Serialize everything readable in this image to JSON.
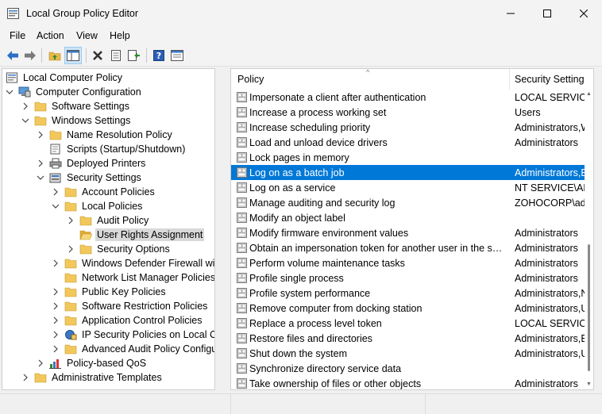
{
  "window": {
    "title": "Local Group Policy Editor",
    "accent": "#0078d7"
  },
  "menu": [
    "File",
    "Action",
    "View",
    "Help"
  ],
  "toolbar": {
    "icons": [
      "back-arrow-icon",
      "forward-arrow-icon",
      "up-folder-icon",
      "show-hide-tree-icon",
      "delete-icon",
      "properties-icon",
      "export-list-icon",
      "help-icon",
      "filter-icon"
    ]
  },
  "tree": {
    "nodes": [
      {
        "label": "Local Computer Policy",
        "icon": "policy-icon"
      },
      {
        "label": "Computer Configuration",
        "icon": "computer-icon"
      },
      {
        "label": "Software Settings",
        "icon": "folder-icon"
      },
      {
        "label": "Windows Settings",
        "icon": "folder-icon"
      },
      {
        "label": "Name Resolution Policy",
        "icon": "folder-icon"
      },
      {
        "label": "Scripts (Startup/Shutdown)",
        "icon": "scripts-icon"
      },
      {
        "label": "Deployed Printers",
        "icon": "printer-icon"
      },
      {
        "label": "Security Settings",
        "icon": "security-icon"
      },
      {
        "label": "Account Policies",
        "icon": "folder-icon"
      },
      {
        "label": "Local Policies",
        "icon": "folder-icon"
      },
      {
        "label": "Audit Policy",
        "icon": "folder-icon"
      },
      {
        "label": "User Rights Assignment",
        "icon": "folder-open-icon"
      },
      {
        "label": "Security Options",
        "icon": "folder-icon"
      },
      {
        "label": "Windows Defender Firewall wit",
        "icon": "folder-icon"
      },
      {
        "label": "Network List Manager Policies",
        "icon": "folder-icon"
      },
      {
        "label": "Public Key Policies",
        "icon": "folder-icon"
      },
      {
        "label": "Software Restriction Policies",
        "icon": "folder-icon"
      },
      {
        "label": "Application Control Policies",
        "icon": "folder-icon"
      },
      {
        "label": "IP Security Policies on Local Co",
        "icon": "ipsec-icon"
      },
      {
        "label": "Advanced Audit Policy Configu",
        "icon": "folder-icon"
      },
      {
        "label": "Policy-based QoS",
        "icon": "chart-icon"
      },
      {
        "label": "Administrative Templates",
        "icon": "folder-icon"
      }
    ]
  },
  "list": {
    "columns": [
      "Policy",
      "Security Setting"
    ],
    "rows": [
      {
        "policy": "Impersonate a client after authentication",
        "setting": "LOCAL SERVICE,N"
      },
      {
        "policy": "Increase a process working set",
        "setting": "Users"
      },
      {
        "policy": "Increase scheduling priority",
        "setting": "Administrators,W"
      },
      {
        "policy": "Load and unload device drivers",
        "setting": "Administrators"
      },
      {
        "policy": "Lock pages in memory",
        "setting": ""
      },
      {
        "policy": "Log on as a batch job",
        "setting": "Administrators,B"
      },
      {
        "policy": "Log on as a service",
        "setting": "NT SERVICE\\ALL"
      },
      {
        "policy": "Manage auditing and security log",
        "setting": "ZOHOCORP\\ada"
      },
      {
        "policy": "Modify an object label",
        "setting": ""
      },
      {
        "policy": "Modify firmware environment values",
        "setting": "Administrators"
      },
      {
        "policy": "Obtain an impersonation token for another user in the same...",
        "setting": "Administrators"
      },
      {
        "policy": "Perform volume maintenance tasks",
        "setting": "Administrators"
      },
      {
        "policy": "Profile single process",
        "setting": "Administrators"
      },
      {
        "policy": "Profile system performance",
        "setting": "Administrators,N"
      },
      {
        "policy": "Remove computer from docking station",
        "setting": "Administrators,U"
      },
      {
        "policy": "Replace a process level token",
        "setting": "LOCAL SERVICE,N"
      },
      {
        "policy": "Restore files and directories",
        "setting": "Administrators,B"
      },
      {
        "policy": "Shut down the system",
        "setting": "Administrators,U"
      },
      {
        "policy": "Synchronize directory service data",
        "setting": ""
      },
      {
        "policy": "Take ownership of files or other objects",
        "setting": "Administrators"
      }
    ]
  }
}
